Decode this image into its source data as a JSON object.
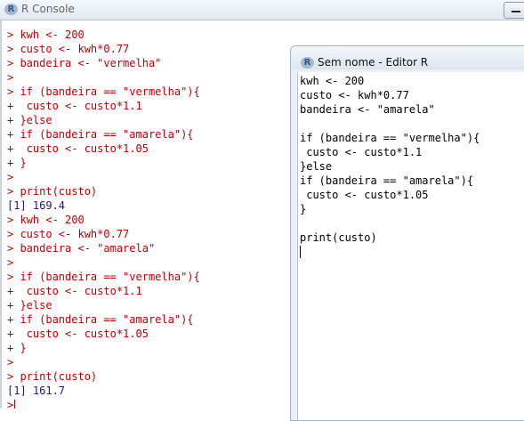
{
  "console": {
    "title": "R Console",
    "lines": [
      {
        "text": "> kwh <- 200",
        "kind": "in"
      },
      {
        "text": "> custo <- kwh*0.77",
        "kind": "in"
      },
      {
        "text": "> bandeira <- \"vermelha\"",
        "kind": "in"
      },
      {
        "text": ">",
        "kind": "in"
      },
      {
        "text": "> if (bandeira == \"vermelha\"){",
        "kind": "in"
      },
      {
        "text": "+  custo <- custo*1.1",
        "kind": "in"
      },
      {
        "text": "+ }else",
        "kind": "in"
      },
      {
        "text": "+ if (bandeira == \"amarela\"){",
        "kind": "in"
      },
      {
        "text": "+  custo <- custo*1.05",
        "kind": "in"
      },
      {
        "text": "+ }",
        "kind": "in"
      },
      {
        "text": ">",
        "kind": "in"
      },
      {
        "text": "> print(custo)",
        "kind": "in"
      },
      {
        "text": "[1] 169.4",
        "kind": "out"
      },
      {
        "text": "> kwh <- 200",
        "kind": "in"
      },
      {
        "text": "> custo <- kwh*0.77",
        "kind": "in"
      },
      {
        "text": "> bandeira <- \"amarela\"",
        "kind": "in"
      },
      {
        "text": ">",
        "kind": "in"
      },
      {
        "text": "> if (bandeira == \"vermelha\"){",
        "kind": "in"
      },
      {
        "text": "+  custo <- custo*1.1",
        "kind": "in"
      },
      {
        "text": "+ }else",
        "kind": "in"
      },
      {
        "text": "+ if (bandeira == \"amarela\"){",
        "kind": "in"
      },
      {
        "text": "+  custo <- custo*1.05",
        "kind": "in"
      },
      {
        "text": "+ }",
        "kind": "in"
      },
      {
        "text": ">",
        "kind": "in"
      },
      {
        "text": "> print(custo)",
        "kind": "in"
      },
      {
        "text": "[1] 161.7",
        "kind": "out"
      }
    ],
    "prompt": ">"
  },
  "editor": {
    "title": "Sem nome - Editor R",
    "lines": [
      "kwh <- 200",
      "custo <- kwh*0.77",
      "bandeira <- \"amarela\"",
      "",
      "if (bandeira == \"vermelha\"){",
      " custo <- custo*1.1",
      "}else",
      "if (bandeira == \"amarela\"){",
      " custo <- custo*1.05",
      "}",
      "",
      "print(custo)"
    ]
  }
}
